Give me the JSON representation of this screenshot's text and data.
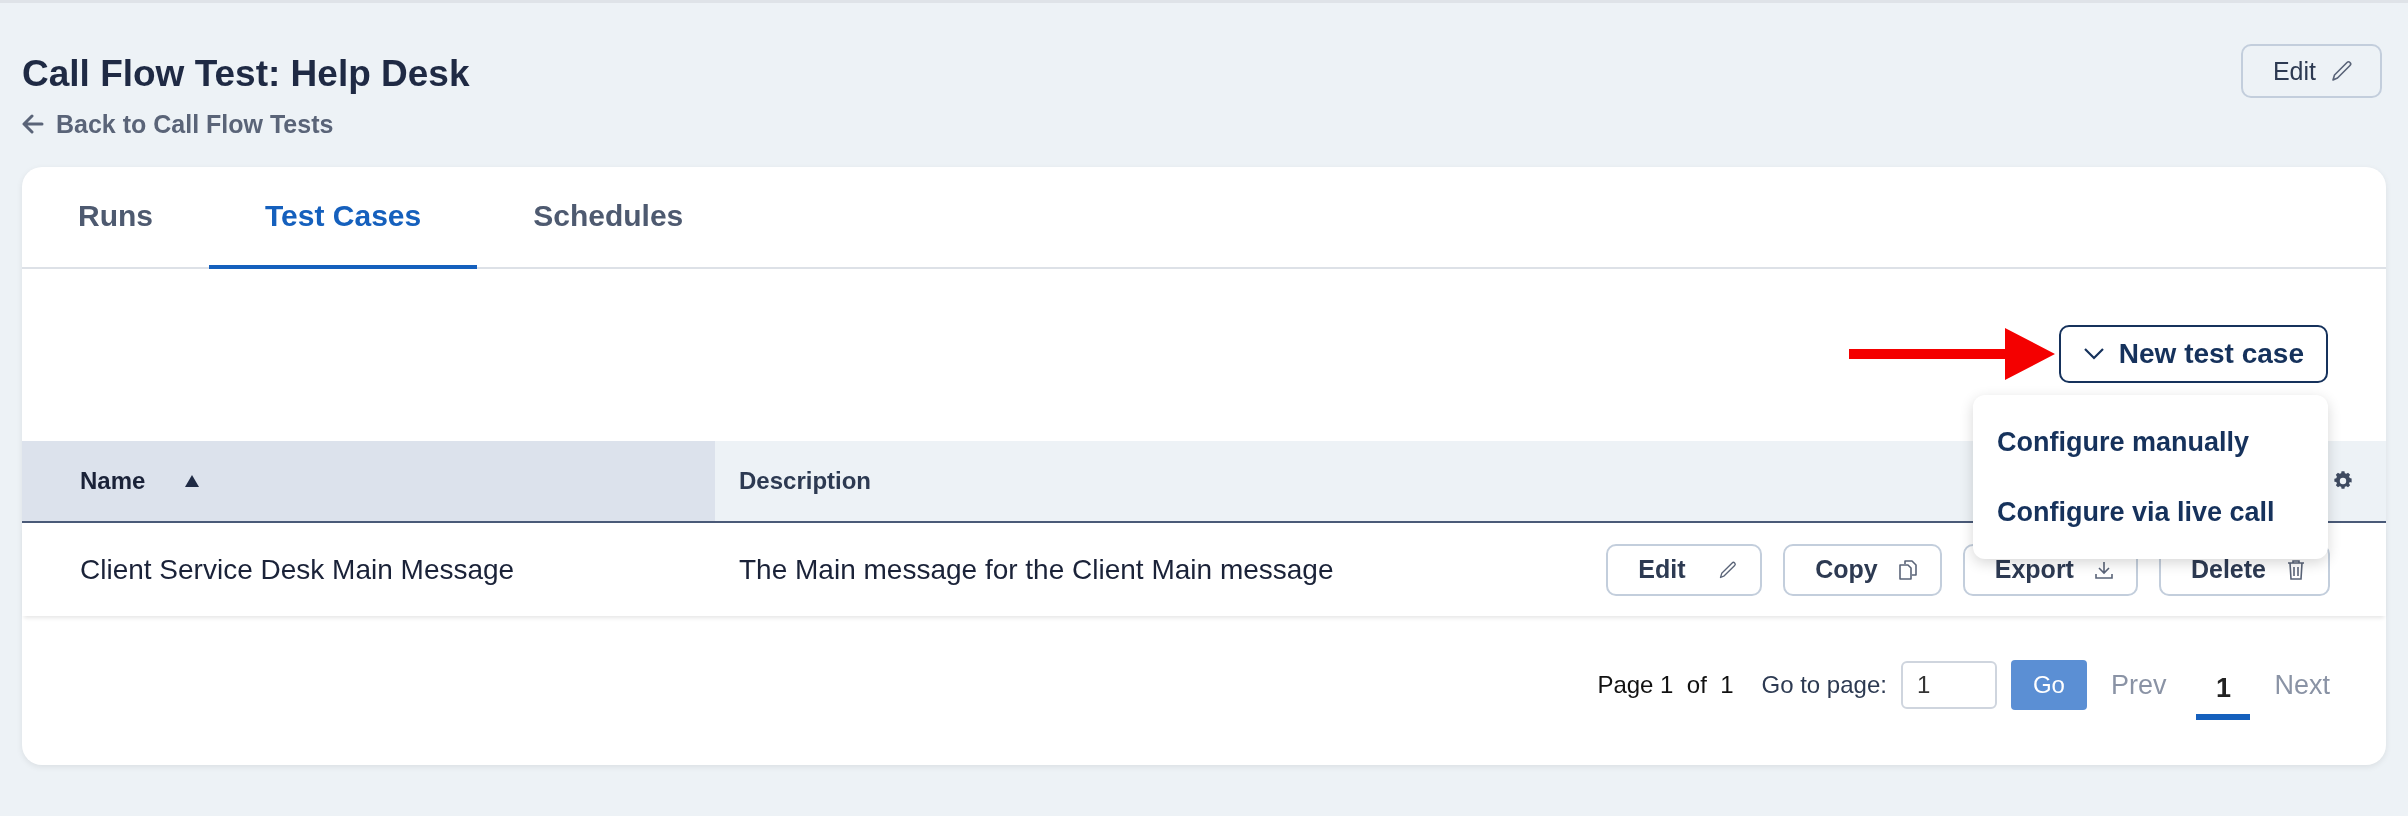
{
  "page": {
    "title": "Call Flow Test: Help Desk",
    "back_link": "Back to Call Flow Tests",
    "edit_button": "Edit"
  },
  "tabs": [
    {
      "label": "Runs",
      "selected": false
    },
    {
      "label": "Test Cases",
      "selected": true
    },
    {
      "label": "Schedules",
      "selected": false
    }
  ],
  "new_button": {
    "label": "New test case",
    "expanded": true
  },
  "menu_items": [
    "Configure manually",
    "Configure via live call"
  ],
  "table": {
    "columns": [
      {
        "label": "Name",
        "sorted": true
      },
      {
        "label": "Description",
        "sorted": false
      }
    ],
    "rows": [
      {
        "name": "Client Service Desk Main Message",
        "description": "The Main message for the Client Main message",
        "actions": [
          {
            "label": "Edit",
            "kind": "edit"
          },
          {
            "label": "Copy",
            "kind": "copy"
          },
          {
            "label": "Export",
            "kind": "export"
          },
          {
            "label": "Delete",
            "kind": "delete"
          }
        ]
      }
    ]
  },
  "pagination": {
    "page_label": "Page 1",
    "of_label": "of",
    "total": "1",
    "goto_label": "Go to page:",
    "goto_value": "1",
    "go_button": "Go",
    "prev": {
      "label": "Prev",
      "disabled": true
    },
    "pages": [
      {
        "label": "1",
        "selected": true
      }
    ],
    "next": {
      "label": "Next",
      "disabled": true
    }
  }
}
